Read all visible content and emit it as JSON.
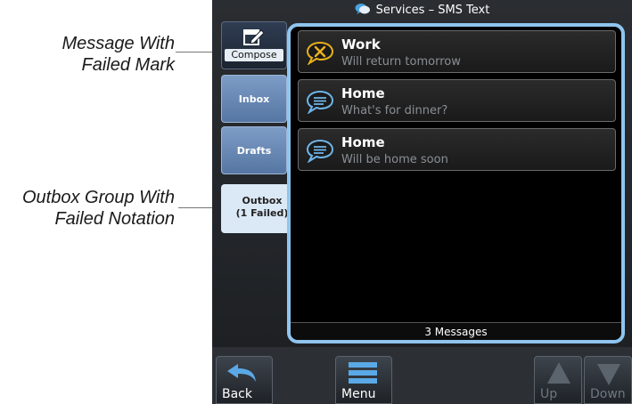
{
  "callouts": {
    "failed_mark": [
      "Message With",
      "Failed Mark"
    ],
    "failed_notation": [
      "Outbox  Group With",
      "Failed  Notation"
    ]
  },
  "window": {
    "title": "Services – SMS Text",
    "icon": "chat-bubbles-icon"
  },
  "tabs": {
    "compose_label": "Compose",
    "inbox_label": "Inbox",
    "drafts_label": "Drafts",
    "outbox_line1": "Outbox",
    "outbox_line2": "(1 Failed)"
  },
  "messages": [
    {
      "name": "Work",
      "text": "Will return tomorrow",
      "icon": "failed-message-icon",
      "status": "failed"
    },
    {
      "name": "Home",
      "text": "What's for dinner?",
      "icon": "message-bubble-icon",
      "status": "ok"
    },
    {
      "name": "Home",
      "text": "Will be home soon",
      "icon": "message-bubble-icon",
      "status": "ok"
    }
  ],
  "message_count": "3 Messages",
  "softkeys": {
    "back": "Back",
    "menu": "Menu",
    "up": "Up",
    "down": "Down"
  },
  "colors": {
    "panel_border": "#8fc5ef",
    "active_tab": "#dbe9f7",
    "failed_mark": "#e8b21c"
  }
}
